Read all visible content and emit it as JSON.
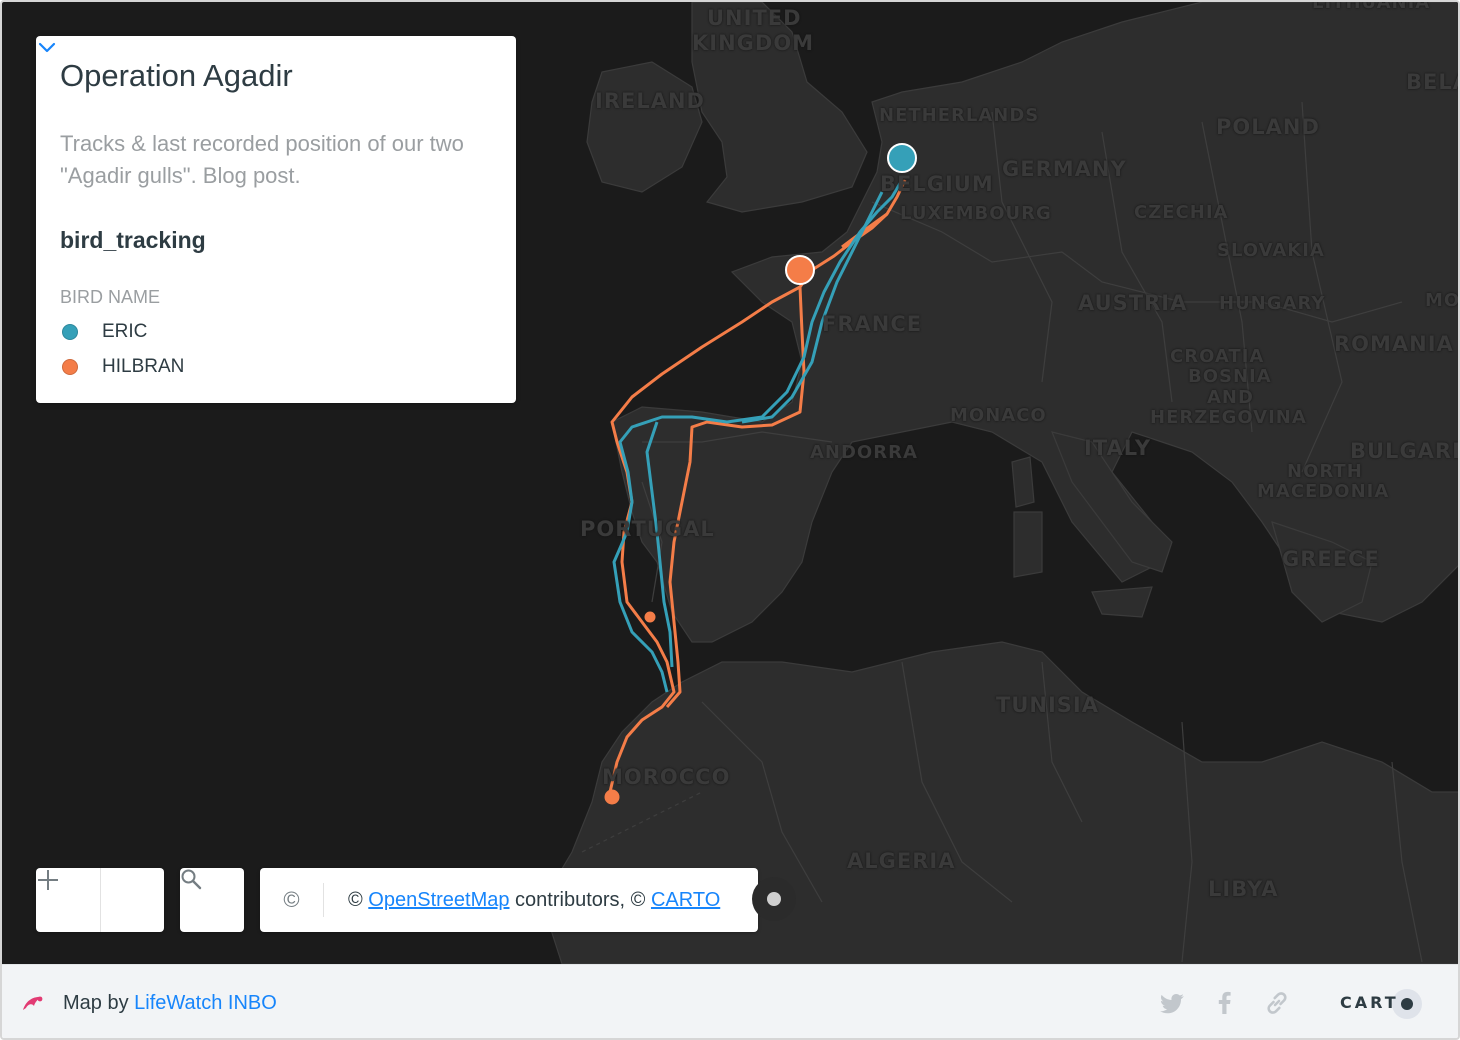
{
  "legend": {
    "title": "Operation Agadir",
    "description": "Tracks & last recorded position of our two \"Agadir gulls\". Blog post.",
    "layer_name": "bird_tracking",
    "attribute_title": "BIRD NAME",
    "items": [
      {
        "label": "ERIC",
        "color": "#35a0b8"
      },
      {
        "label": "HILBRAN",
        "color": "#f47d48"
      }
    ],
    "toggle_icon": "chevron-down-icon"
  },
  "map_labels": [
    "UNITED",
    "KINGDOM",
    "IRELAND",
    "NETHERLANDS",
    "BELGIUM",
    "LUXEMBOURG",
    "GERMANY",
    "POLAND",
    "LITHUANIA",
    "BELA",
    "CZECHIA",
    "SLOVAKIA",
    "AUSTRIA",
    "HUNGARY",
    "MO",
    "ROMANIA",
    "FRANCE",
    "CROATIA",
    "BOSNIA",
    "AND",
    "HERZEGOVINA",
    "MONACO",
    "ANDORRA",
    "ITALY",
    "BULGARIA",
    "NORTH",
    "MACEDONIA",
    "PORTUGAL",
    "GREECE",
    "TUNISIA",
    "MOROCCO",
    "ALGERIA",
    "LIBYA"
  ],
  "controls": {
    "zoom_out_icon": "minus-icon",
    "zoom_in_icon": "plus-icon",
    "search_icon": "search-icon",
    "attribution_icon": "©",
    "attribution_prefix": "© ",
    "osm_link": "OpenStreetMap",
    "attribution_middle": " contributors, © ",
    "carto_link": "CARTO"
  },
  "footer": {
    "map_by": "Map by ",
    "author": "LifeWatch INBO",
    "social": [
      "twitter-icon",
      "facebook-icon",
      "link-icon"
    ],
    "brand": "CART"
  },
  "colors": {
    "eric": "#35a0b8",
    "hilbran": "#f47d48",
    "map_bg": "#1b1b1b",
    "land": "#2c2c2c",
    "link": "#1785fb"
  }
}
